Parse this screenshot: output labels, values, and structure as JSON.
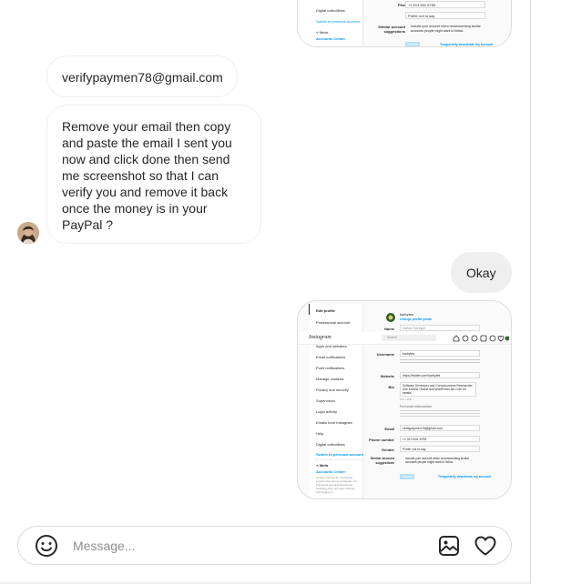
{
  "messages": {
    "incoming_1": "verifypaymen78@gmail.com",
    "incoming_2": "Remove your email then copy and paste the email I sent you now and click done then send me screenshot so that I can verify you and remove it back once the money is in your PayPal ?",
    "outgoing_1": "Okay"
  },
  "screenshot_top": {
    "rows": [
      "Digital collectibles",
      "Switch to personal account"
    ],
    "fields": {
      "phone_label": "Phone number",
      "phone_value": "+1 513 631 6783",
      "gender_label": "Gender",
      "gender_value": "Prefer not to say",
      "similar_label": "Similar account suggestions",
      "similar_text": "Include your account when recommending similar accounts people might want to follow.",
      "meta_label": "Accounts Center",
      "meta_brand": "∞ Meta",
      "submit": "Submit",
      "deactivate": "Temporarily deactivate my account"
    }
  },
  "screenshot_bottom": {
    "brand": "Instagram",
    "search_placeholder": "Search",
    "menu": [
      "Edit profile",
      "Professional account",
      "Apps and websites",
      "Email notifications",
      "Push notifications",
      "Manage contacts",
      "Privacy and security",
      "Supervision",
      "Login activity",
      "Emails from Instagram",
      "Help",
      "Digital collectibles",
      "Switch to personal account"
    ],
    "meta_brand": "∞ Meta",
    "meta_label": "Accounts Center",
    "meta_desc": "Control settings for connected experiences across Instagram, the Facebook app and Messenger, including story and post sharing and logging in.",
    "username_display": "karbytes",
    "change_photo": "Change profile photo",
    "fields": {
      "name_label": "Name",
      "name_value": "Karbhe Beringer",
      "username_label": "Username",
      "username_value": "karbytes",
      "website_label": "Website",
      "website_value": "https://twitter.com/karbytes",
      "bio_label": "Bio",
      "bio_value": "Software Developer and Consciousness Researcher. See Karbhe Oberst and WordPress dot Com for details.",
      "bio_count": "101 / 150",
      "personal_info": "Personal information",
      "email_label": "Email",
      "email_value": "verifypaymen78@gmail.com",
      "phone_label": "Phone number",
      "phone_value": "+1 513 631 6783",
      "gender_label": "Gender",
      "gender_value": "Prefer not to say",
      "similar_label": "Similar account suggestions",
      "similar_text": "Include your account when recommending similar accounts people might want to follow.",
      "submit": "Submit",
      "deactivate": "Temporarily deactivate my account"
    }
  },
  "composer": {
    "placeholder": "Message..."
  },
  "icons": {
    "emoji": "emoji-icon",
    "image": "image-icon",
    "heart": "heart-icon"
  },
  "colors": {
    "accent": "#0095f6",
    "outgoing_bubble": "#efefef",
    "border": "#dbdbdb"
  }
}
